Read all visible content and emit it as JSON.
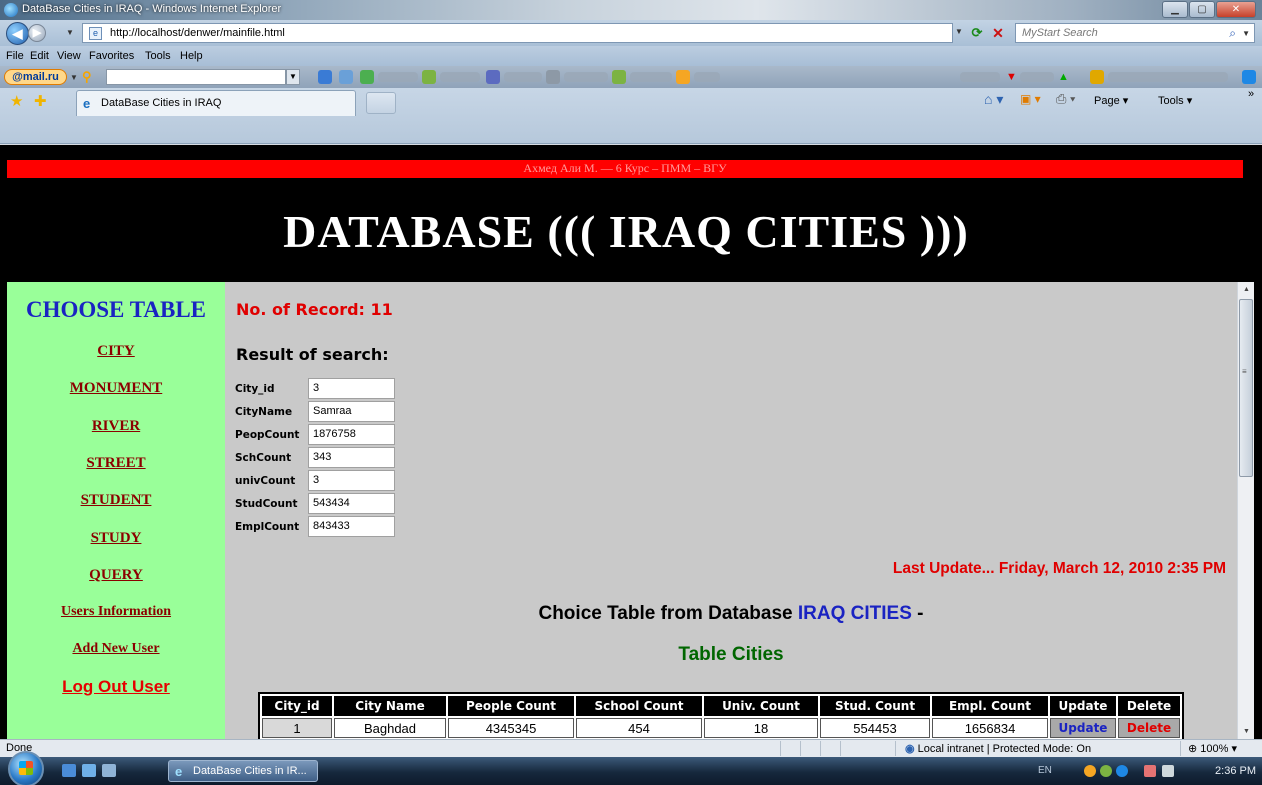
{
  "window": {
    "title": "DataBase Cities in IRAQ - Windows Internet Explorer",
    "address": "http://localhost/denwer/mainfile.html",
    "search_placeholder": "MyStart Search"
  },
  "menu": [
    "File",
    "Edit",
    "View",
    "Favorites",
    "Tools",
    "Help"
  ],
  "toolbar": {
    "mailru_label": "@mail.ru"
  },
  "tabs": {
    "active_label": "DataBase Cities in IRAQ"
  },
  "commandbar": {
    "page_label": "Page ▾",
    "tools_label": "Tools ▾",
    "more_label": "»"
  },
  "page": {
    "banner": "Ахмед Али М. — 6 Курс – ПММ – ВГУ",
    "title": "DATABASE ((( IRAQ CITIES )))",
    "sidebar": {
      "heading": "CHOOSE TABLE",
      "links": [
        "CITY",
        "MONUMENT",
        "RIVER",
        "STREET",
        "STUDENT",
        "STUDY",
        "QUERY",
        "Users Information",
        "Add New User"
      ],
      "logout": "Log Out User"
    },
    "record_count": "No. of Record: 11",
    "result_heading": "Result of search:",
    "fields": [
      {
        "label": "City_id",
        "value": "3"
      },
      {
        "label": "CityName",
        "value": "Samraa"
      },
      {
        "label": "PeopCount",
        "value": "1876758"
      },
      {
        "label": "SchCount",
        "value": "343"
      },
      {
        "label": "univCount",
        "value": "3"
      },
      {
        "label": "StudCount",
        "value": "543434"
      },
      {
        "label": "EmplCount",
        "value": "843433"
      }
    ],
    "last_update": "Last Update... Friday, March 12, 2010 2:35 PM",
    "choice_prefix": "Choice Table from Database ",
    "choice_db": "IRAQ CITIES",
    "choice_suffix": " -",
    "table_title": "Table Cities",
    "table": {
      "headers": [
        "City_id",
        "City Name",
        "People Count",
        "School Count",
        "Univ. Count",
        "Stud. Count",
        "Empl. Count",
        "Update",
        "Delete"
      ],
      "rows": [
        [
          "1",
          "Baghdad",
          "4345345",
          "454",
          "18",
          "554453",
          "1656834",
          "Update",
          "Delete"
        ]
      ]
    }
  },
  "statusbar": {
    "text": "Done",
    "zone": "Local intranet | Protected Mode: On",
    "zoom": "100%"
  },
  "taskbar": {
    "task_label": "DataBase Cities in IR...",
    "tray_lang": "EN",
    "clock": "2:36 PM"
  }
}
